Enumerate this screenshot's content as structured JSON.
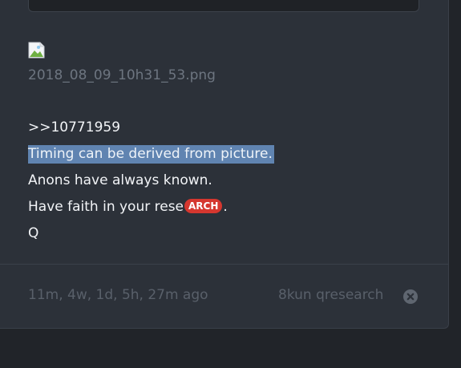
{
  "attachment": {
    "filename": "2018_08_09_10h31_53.png",
    "image_icon": "broken-image-icon"
  },
  "post": {
    "reference": ">>10771959",
    "highlighted_line": "Timing can be derived from picture.",
    "line_known": "Anons have always known.",
    "line_faith_prefix": "Have faith in your rese",
    "archive_badge": "ARCH",
    "line_faith_suffix": ".",
    "signature": "Q"
  },
  "footer": {
    "time_ago": "11m, 4w, 1d, 5h, 27m ago",
    "source": "8kun qresearch",
    "close_icon": "close-circle-icon"
  },
  "colors": {
    "background": "#212429",
    "card": "#2c3139",
    "text": "#f2f4f7",
    "muted_text": "#6d7580",
    "highlight": "#6084b1",
    "badge": "#d5372f"
  }
}
